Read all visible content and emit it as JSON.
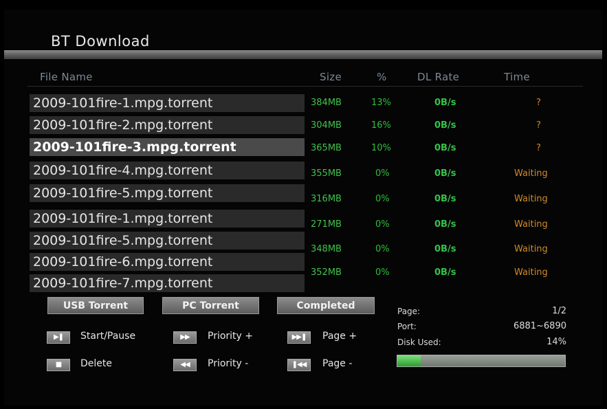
{
  "title": "BT Download",
  "headers": {
    "file_name": "File Name",
    "size": "Size",
    "percent": "%",
    "dl_rate": "DL Rate",
    "time": "Time"
  },
  "files": [
    {
      "name": "2009-101fire-1.mpg.torrent",
      "size": "384MB",
      "percent": "13%",
      "rate": "0B/s",
      "time": "?"
    },
    {
      "name": "2009-101fire-2.mpg.torrent",
      "size": "304MB",
      "percent": "16%",
      "rate": "0B/s",
      "time": "?"
    },
    {
      "name": "2009-101fire-3.mpg.torrent",
      "size": "365MB",
      "percent": "10%",
      "rate": "0B/s",
      "time": "?"
    },
    {
      "name": "2009-101fire-4.mpg.torrent",
      "size": "355MB",
      "percent": "0%",
      "rate": "0B/s",
      "time": "Waiting"
    },
    {
      "name": "2009-101fire-5.mpg.torrent",
      "size": "316MB",
      "percent": "0%",
      "rate": "0B/s",
      "time": "Waiting"
    },
    {
      "name": "2009-101fire-1.mpg.torrent",
      "size": "271MB",
      "percent": "0%",
      "rate": "0B/s",
      "time": "Waiting"
    },
    {
      "name": "2009-101fire-5.mpg.torrent",
      "size": "348MB",
      "percent": "0%",
      "rate": "0B/s",
      "time": "Waiting"
    },
    {
      "name": "2009-101fire-6.mpg.torrent",
      "size": "352MB",
      "percent": "0%",
      "rate": "0B/s",
      "time": "Waiting"
    },
    {
      "name": "2009-101fire-7.mpg.torrent"
    }
  ],
  "buttons": {
    "usb_torrent": "USB Torrent",
    "pc_torrent": "PC Torrent",
    "completed": "Completed"
  },
  "controls": {
    "start_pause": {
      "icon": "play-pause-icon",
      "label": "Start/Pause"
    },
    "priority_up": {
      "icon": "fast-forward-icon",
      "label": "Priority +"
    },
    "page_up": {
      "icon": "skip-next-icon",
      "label": "Page +"
    },
    "delete": {
      "icon": "stop-icon",
      "label": "Delete"
    },
    "priority_down": {
      "icon": "rewind-icon",
      "label": "Priority -"
    },
    "page_down": {
      "icon": "skip-previous-icon",
      "label": "Page -"
    }
  },
  "info": {
    "page_label": "Page:",
    "page_value": "1/2",
    "port_label": "Port:",
    "port_value": "6881~6890",
    "disk_label": "Disk Used:",
    "disk_value": "14%",
    "disk_fraction": 0.14
  },
  "colors": {
    "size": "#3fc24a",
    "rate": "#34c24a",
    "waiting": "#d08a2a",
    "disk_fill": "#2f9a2f"
  }
}
